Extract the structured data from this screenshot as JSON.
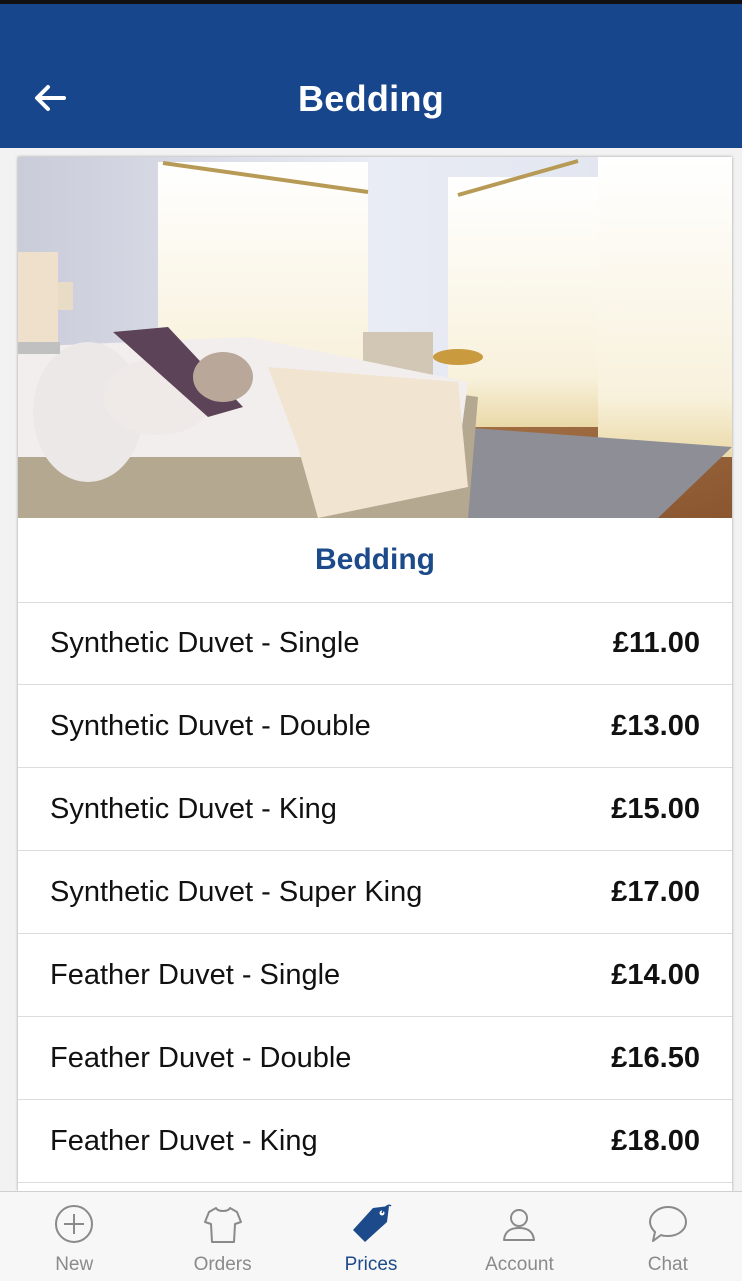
{
  "header": {
    "title": "Bedding",
    "back_icon": "arrow-left-icon"
  },
  "card": {
    "image_alt": "bedroom-photo",
    "section_title": "Bedding",
    "items": [
      {
        "name": "Synthetic Duvet - Single",
        "price": "£11.00"
      },
      {
        "name": "Synthetic Duvet - Double",
        "price": "£13.00"
      },
      {
        "name": "Synthetic Duvet - King",
        "price": "£15.00"
      },
      {
        "name": "Synthetic Duvet - Super King",
        "price": "£17.00"
      },
      {
        "name": "Feather Duvet - Single",
        "price": "£14.00"
      },
      {
        "name": "Feather Duvet - Double",
        "price": "£16.50"
      },
      {
        "name": "Feather Duvet - King",
        "price": "£18.00"
      }
    ]
  },
  "nav": {
    "items": [
      {
        "label": "New",
        "icon": "plus-circle-icon",
        "active": false
      },
      {
        "label": "Orders",
        "icon": "shirt-icon",
        "active": false
      },
      {
        "label": "Prices",
        "icon": "price-tag-icon",
        "active": true
      },
      {
        "label": "Account",
        "icon": "person-icon",
        "active": false
      },
      {
        "label": "Chat",
        "icon": "chat-bubble-icon",
        "active": false
      }
    ]
  },
  "colors": {
    "primary": "#17468c",
    "accent_text": "#1d4a8a",
    "inactive": "#8a8a8a"
  }
}
